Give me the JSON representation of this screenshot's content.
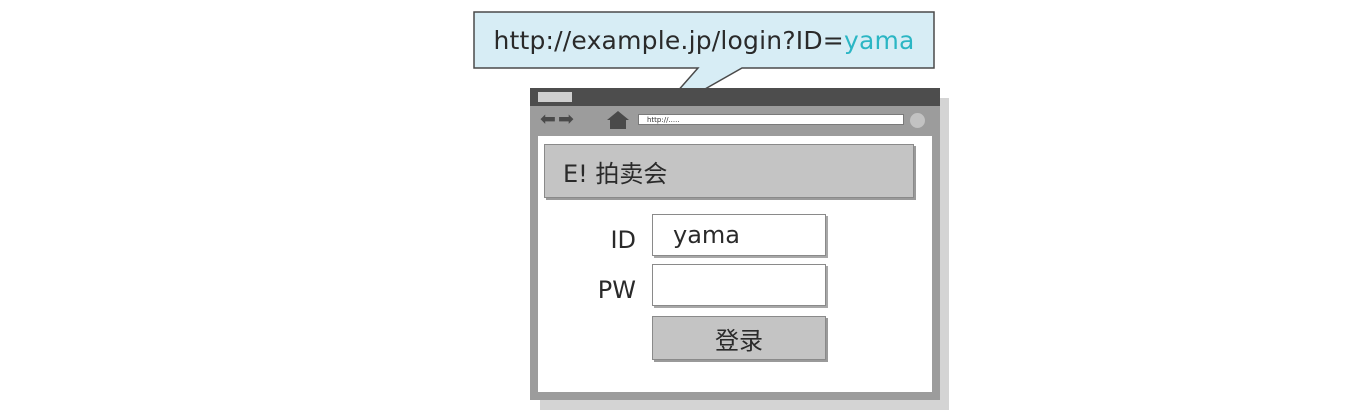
{
  "callout": {
    "url_prefix": "http://example.jp/login?ID=",
    "url_param_value": "yama"
  },
  "browser": {
    "address_text": "http://.....",
    "site_title": "E! 拍卖会",
    "form": {
      "id_label": "ID",
      "id_value": "yama",
      "pw_label": "PW",
      "pw_value": "",
      "login_button_label": "登录"
    }
  },
  "colors": {
    "highlight": "#2bb6c4",
    "title_bar": "#4d4d4d",
    "chrome": "#9c9c9c",
    "header_fill": "#c4c4c4"
  },
  "icons": [
    "back-arrow-icon",
    "forward-arrow-icon",
    "home-icon"
  ]
}
